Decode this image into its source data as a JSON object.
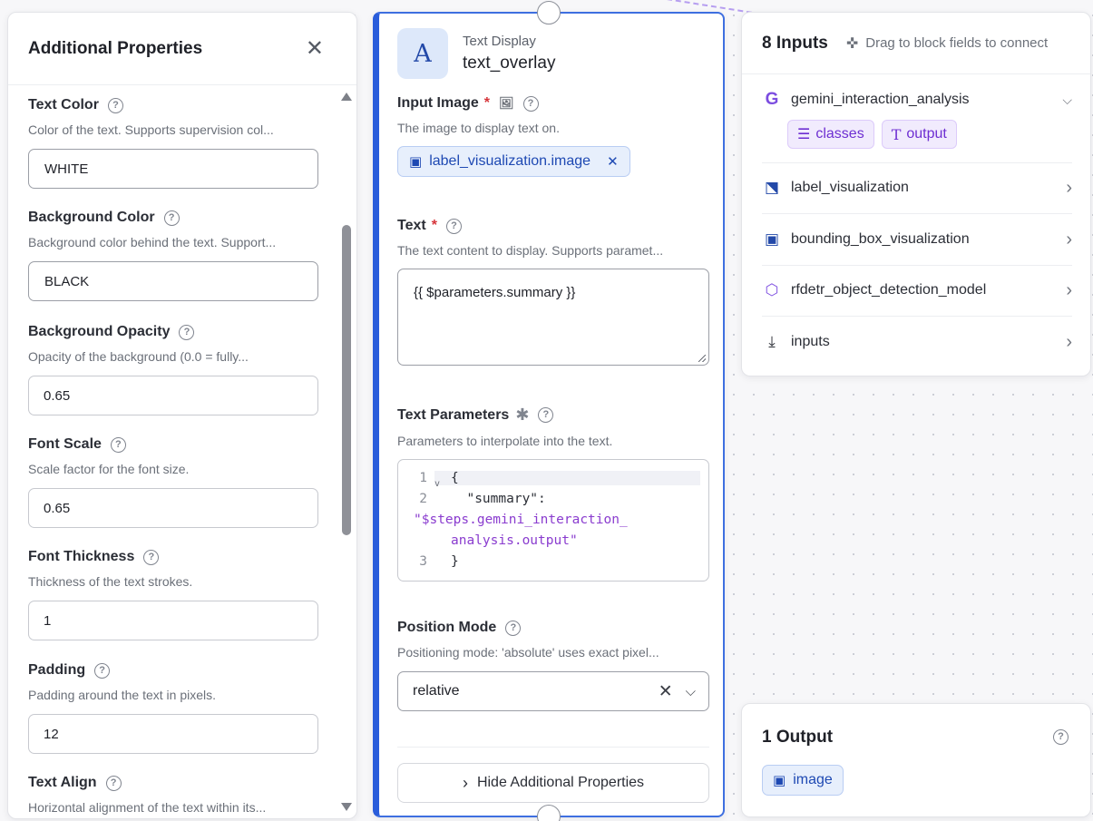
{
  "props": {
    "title": "Additional Properties",
    "fields": [
      {
        "label": "Text Color",
        "desc": "Color of the text. Supports supervision col...",
        "value": "WHITE"
      },
      {
        "label": "Background Color",
        "desc": "Background color behind the text. Support...",
        "value": "BLACK"
      },
      {
        "label": "Background Opacity",
        "desc": "Opacity of the background (0.0 = fully...",
        "value": "0.65"
      },
      {
        "label": "Font Scale",
        "desc": "Scale factor for the font size.",
        "value": "0.65"
      },
      {
        "label": "Font Thickness",
        "desc": "Thickness of the text strokes.",
        "value": "1"
      },
      {
        "label": "Padding",
        "desc": "Padding around the text in pixels.",
        "value": "12"
      },
      {
        "label": "Text Align",
        "desc": "Horizontal alignment of the text within its..."
      }
    ]
  },
  "node": {
    "type_label": "Text Display",
    "name": "text_overlay",
    "avatar_letter": "A",
    "input_image": {
      "label": "Input Image",
      "desc": "The image to display text on.",
      "chip": "label_visualization.image"
    },
    "text": {
      "label": "Text",
      "desc": "The text content to display. Supports paramet...",
      "value": "{{ $parameters.summary }}"
    },
    "text_params": {
      "label": "Text Parameters",
      "desc": "Parameters to interpolate into the text.",
      "lines": [
        {
          "n": "1",
          "text": "{"
        },
        {
          "n": "2",
          "text": "  \"summary\":"
        },
        {
          "n": "",
          "text": "\"$steps.gemini_interaction_"
        },
        {
          "n": "",
          "text": "analysis.output\""
        },
        {
          "n": "3",
          "text": "}"
        }
      ]
    },
    "position_mode": {
      "label": "Position Mode",
      "desc": "Positioning mode: 'absolute' uses exact pixel...",
      "value": "relative"
    },
    "hide_button": "Hide Additional Properties"
  },
  "inputs": {
    "title": "8 Inputs",
    "hint": "Drag to block fields to connect",
    "items": [
      {
        "name": "gemini_interaction_analysis",
        "icon": "gemini-icon"
      },
      {
        "name": "label_visualization",
        "icon": "tag-icon"
      },
      {
        "name": "bounding_box_visualization",
        "icon": "bounding-box-icon"
      },
      {
        "name": "rfdetr_object_detection_model",
        "icon": "graph-nodes-icon"
      },
      {
        "name": "inputs",
        "icon": "download-icon"
      }
    ],
    "gemini_outputs": [
      "classes",
      "output"
    ]
  },
  "outputs": {
    "title": "1 Output",
    "chip": "image"
  },
  "colors": {
    "accent_blue": "#2a5ddb",
    "required_red": "#d6343a",
    "output_purple": "#6e2fd2",
    "gemini_purple": "#7c4de0"
  }
}
